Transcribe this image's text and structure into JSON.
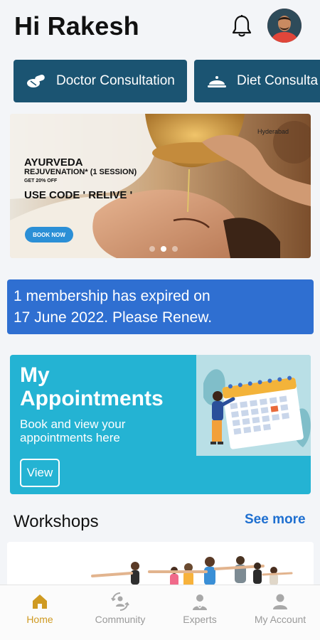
{
  "header": {
    "greeting": "Hi Rakesh",
    "icons": {
      "notifications": "bell-icon",
      "profile": "avatar"
    }
  },
  "services": [
    {
      "label": "Doctor Consultation",
      "icon": "pills-icon"
    },
    {
      "label": "Diet Consulta",
      "icon": "food-cloche-icon"
    }
  ],
  "banner": {
    "title": "AYURVEDA",
    "subtitle": "REJUVENATION* (1 SESSION)",
    "offer": "GET 20% OFF",
    "code": "USE CODE ' RELIVE '",
    "button": "BOOK NOW",
    "city": "Hyderabad",
    "slides": 3,
    "active_slide": 2
  },
  "alert": {
    "line1": "1 membership has expired on",
    "line2": "17 June 2022. Please Renew."
  },
  "appointments": {
    "title": "My Appointments",
    "description": "Book and view your appointments here",
    "button": "View"
  },
  "workshops": {
    "title": "Workshops",
    "see_more": "See more"
  },
  "nav": {
    "items": [
      {
        "label": "Home",
        "icon": "home-icon",
        "active": true
      },
      {
        "label": "Community",
        "icon": "community-icon",
        "active": false
      },
      {
        "label": "Experts",
        "icon": "experts-icon",
        "active": false
      },
      {
        "label": "My Account",
        "icon": "account-icon",
        "active": false
      }
    ]
  },
  "colors": {
    "chip": "#1b5472",
    "alert": "#2f6fd1",
    "appointments": "#24b3d3",
    "link": "#1e6fd0",
    "nav_active": "#cf9a22"
  }
}
